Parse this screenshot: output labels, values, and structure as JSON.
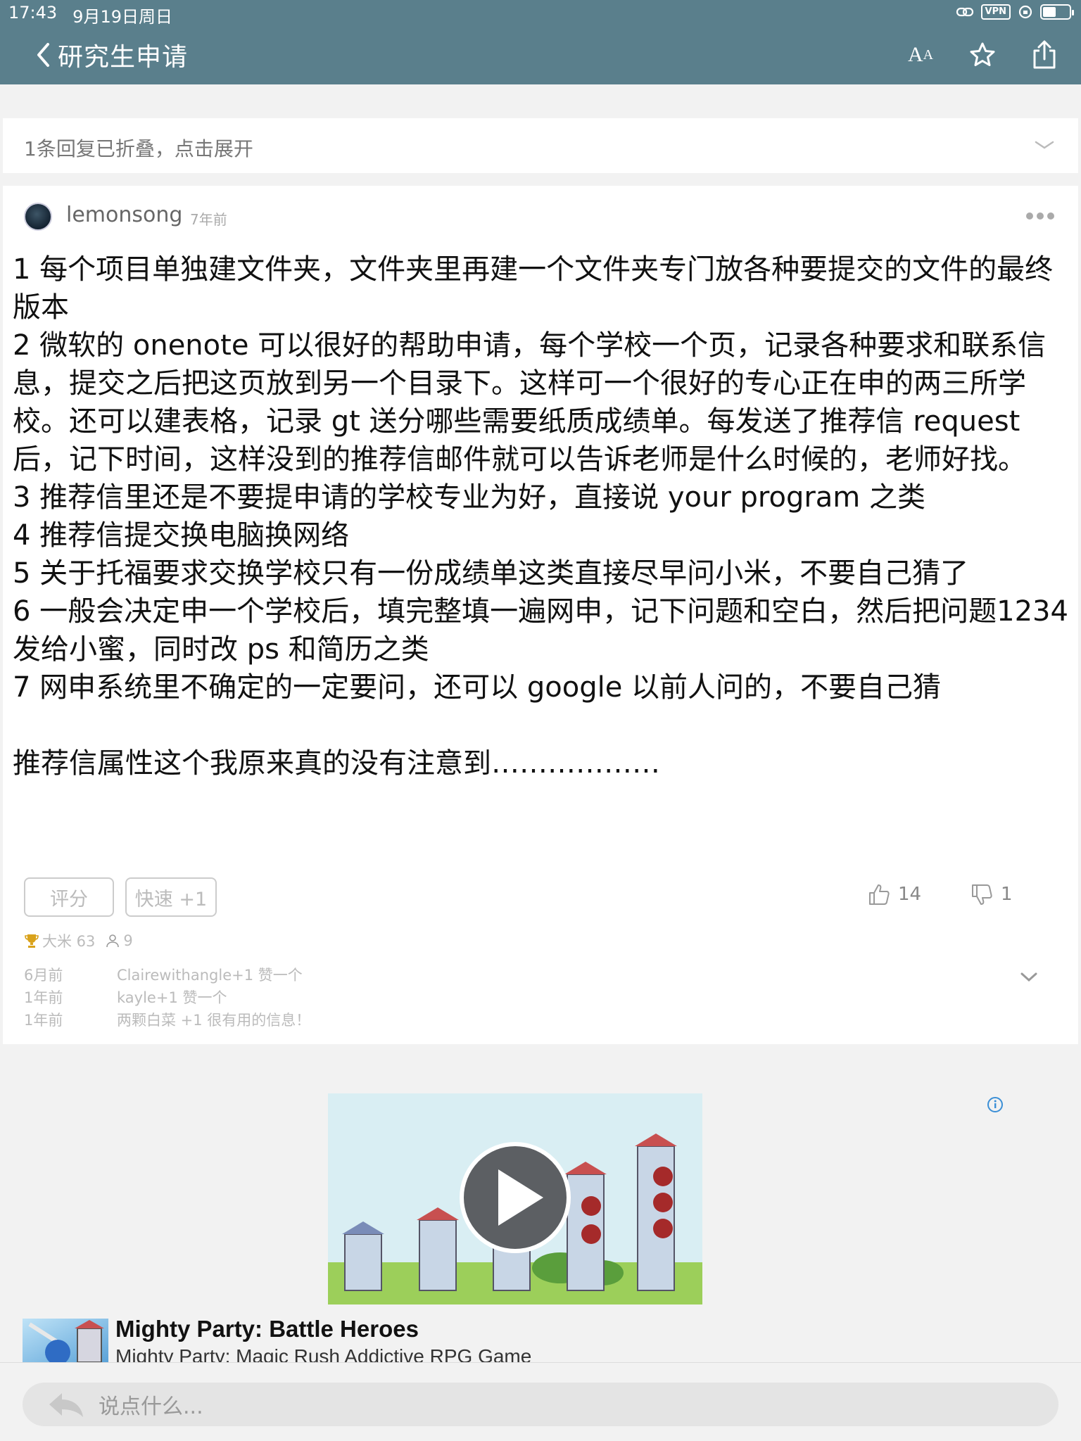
{
  "status_bar": {
    "time": "17:43",
    "date": "9月19日周日",
    "vpn": "VPN"
  },
  "nav": {
    "title": "研究生申请",
    "text_size_label": "A",
    "text_size_label_small": "A"
  },
  "folded_reply": {
    "text": "1条回复已折叠，点击展开"
  },
  "post": {
    "author": "lemonsong",
    "time": "7年前",
    "content": "1 每个项目单独建文件夹，文件夹里再建一个文件夹专门放各种要提交的文件的最终版本\n2 微软的 onenote 可以很好的帮助申请，每个学校一个页，记录各种要求和联系信息，提交之后把这页放到另一个目录下。这样可一个很好的专心正在申的两三所学校。还可以建表格，记录 gt 送分哪些需要纸质成绩单。每发送了推荐信 request 后，记下时间，这样没到的推荐信邮件就可以告诉老师是什么时候的，老师好找。\n3 推荐信里还是不要提申请的学校专业为好，直接说 your program 之类\n4 推荐信提交换电脑换网络\n5 关于托福要求交换学校只有一份成绩单这类直接尽早问小米，不要自己猜了\n6 一般会决定申一个学校后，填完整填一遍网申，记下问题和空白，然后把问题1234发给小蜜，同时改 ps 和简历之类\n7 网申系统里不确定的一定要问，还可以 google 以前人问的，不要自己猜\n\n推荐信属性这个我原来真的没有注意到………………",
    "rate_button": "评分",
    "quick_button": "快速 +1",
    "likes": "14",
    "dislikes": "1",
    "rice_label": "大米 63",
    "raters": "9",
    "rate_log": [
      {
        "time": "6月前",
        "text": "Clairewithangle+1 赞一个"
      },
      {
        "time": "1年前",
        "text": "kayle+1 赞一个"
      },
      {
        "time": "1年前",
        "text": "两颗白菜 +1 很有用的信息！"
      }
    ]
  },
  "ad": {
    "title": "Mighty Party: Battle Heroes",
    "subtitle": "Mighty Party: Magic Rush Addictive RPG Game"
  },
  "comment_box": {
    "placeholder": "说点什么..."
  },
  "colors": {
    "nav_bg": "#5a7f8c",
    "page_bg": "#f2f2f2"
  }
}
